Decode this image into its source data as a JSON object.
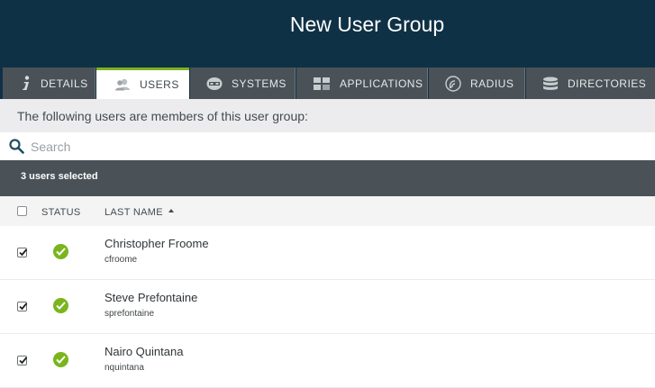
{
  "header": {
    "title": "New User Group"
  },
  "tabs": [
    {
      "label": "DETAILS",
      "icon": "info-icon",
      "active": false
    },
    {
      "label": "USERS",
      "icon": "users-icon",
      "active": true
    },
    {
      "label": "SYSTEMS",
      "icon": "systems-icon",
      "active": false
    },
    {
      "label": "APPLICATIONS",
      "icon": "applications-icon",
      "active": false
    },
    {
      "label": "RADIUS",
      "icon": "radius-icon",
      "active": false
    },
    {
      "label": "DIRECTORIES",
      "icon": "directories-icon",
      "active": false
    }
  ],
  "intro_text": "The following users are members of this user group:",
  "search": {
    "placeholder": "Search",
    "value": ""
  },
  "selection_summary": "3 users selected",
  "table": {
    "columns": {
      "status": "STATUS",
      "last_name": "LAST NAME"
    },
    "sort": "last_name ascending",
    "rows": [
      {
        "name": "Christopher Froome",
        "username": "cfroome",
        "checked": true,
        "status": "active"
      },
      {
        "name": "Steve Prefontaine",
        "username": "sprefontaine",
        "checked": true,
        "status": "active"
      },
      {
        "name": "Nairo Quintana",
        "username": "nquintana",
        "checked": true,
        "status": "active"
      }
    ]
  },
  "colors": {
    "header_bg": "#0f3145",
    "tab_bg": "#4a5257",
    "accent": "#7db320",
    "status_ok": "#7ab51d"
  }
}
